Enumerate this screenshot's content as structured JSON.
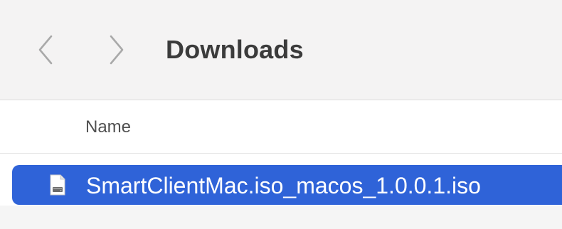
{
  "toolbar": {
    "title": "Downloads",
    "back_icon": "chevron-left-icon",
    "forward_icon": "chevron-right-icon"
  },
  "list_header": {
    "name_column": "Name"
  },
  "files": [
    {
      "name": "SmartClientMac.iso_macos_1.0.0.1.iso",
      "icon": "disk-image-icon",
      "selected": true
    }
  ],
  "colors": {
    "selection": "#2f63d8",
    "toolbar_bg": "#f4f3f3",
    "title_text": "#3b3b3b"
  }
}
